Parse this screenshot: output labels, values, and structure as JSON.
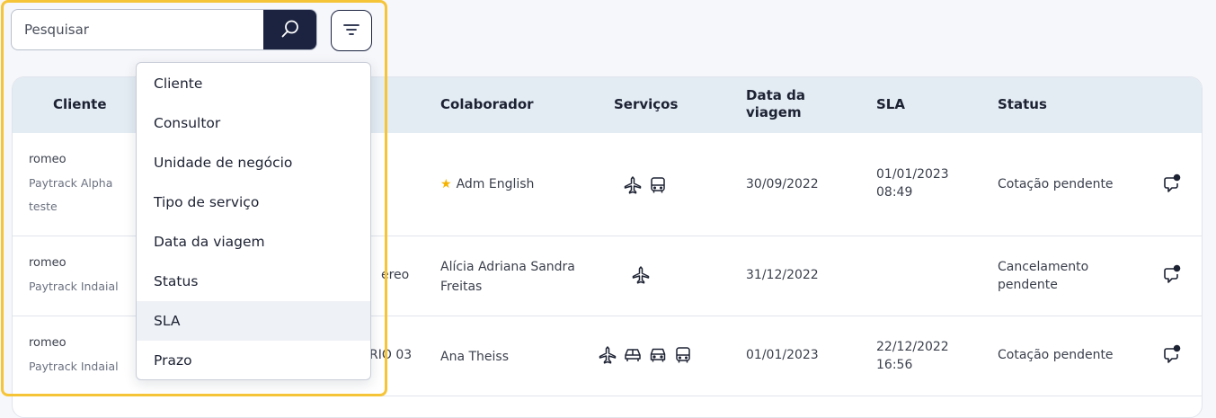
{
  "search": {
    "placeholder": "Pesquisar"
  },
  "filter_menu": {
    "items": [
      "Cliente",
      "Consultor",
      "Unidade de negócio",
      "Tipo de serviço",
      "Data da viagem",
      "Status",
      "SLA",
      "Prazo"
    ],
    "active_item": "SLA"
  },
  "table": {
    "headers": {
      "cliente": "Cliente",
      "colaborador": "Colaborador",
      "servicos": "Serviços",
      "data_line1": "Data da",
      "data_line2": "viagem",
      "sla": "SLA",
      "status": "Status"
    },
    "rows": [
      {
        "cliente": "romeo",
        "empresa": "Paytrack Alpha",
        "extra": "teste",
        "partial": "",
        "colaborador": "Adm English",
        "colaborador_line2": "",
        "starred": true,
        "servicos": [
          "plane-icon",
          "bus-icon"
        ],
        "data_viagem": "30/09/2022",
        "sla_date": "01/01/2023",
        "sla_time": "08:49",
        "status_line1": "Cotação pendente",
        "status_line2": ""
      },
      {
        "cliente": "romeo",
        "empresa": "Paytrack Indaial",
        "extra": "",
        "partial": "ereo",
        "colaborador": "Alícia Adriana Sandra",
        "colaborador_line2": "Freitas",
        "starred": false,
        "servicos": [
          "plane-icon"
        ],
        "data_viagem": "31/12/2022",
        "sla_date": "",
        "sla_time": "",
        "status_line1": "Cancelamento",
        "status_line2": "pendente"
      },
      {
        "cliente": "romeo",
        "empresa": "Paytrack Indaial",
        "extra": "",
        "partial": "RIO 03",
        "colaborador": "Ana Theiss",
        "colaborador_line2": "",
        "starred": false,
        "servicos": [
          "plane-icon",
          "car-icon",
          "car-front-icon",
          "bus-icon"
        ],
        "data_viagem": "01/01/2023",
        "sla_date": "22/12/2022",
        "sla_time": "16:56",
        "status_line1": "Cotação pendente",
        "status_line2": ""
      }
    ]
  },
  "colors": {
    "header_bg": "#e3ebf3",
    "search_button": "#1b2340",
    "highlight_frame": "#f6c437",
    "star": "#f5b301"
  }
}
